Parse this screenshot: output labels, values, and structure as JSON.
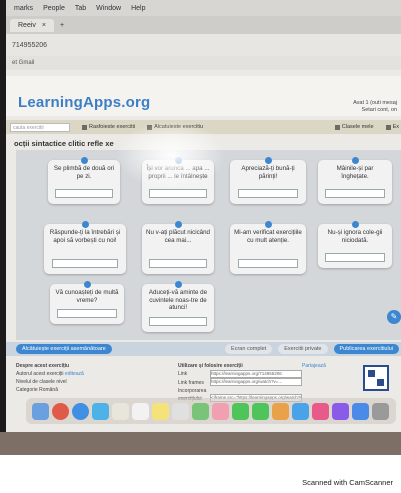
{
  "menubar": {
    "items": [
      "marks",
      "People",
      "Tab",
      "Window",
      "Help"
    ]
  },
  "browser": {
    "tab_label": "Reeiv",
    "tab_close": "×",
    "tab_add": "+",
    "url": "714955206",
    "bookmark": "et  Gmail"
  },
  "site": {
    "logo": "LearningApps.org",
    "header_right_line1": "Avat 1 (outi mesaj",
    "header_right_line2": "Setari cont, on"
  },
  "toolbar": {
    "search_placeholder": "cauta exercitii",
    "browse_label": "Rasfoieste exercitii",
    "create_label": "Alcatuieste exercitiu",
    "classes_label": "Clasele mele",
    "my_label": "Ex"
  },
  "page": {
    "title": "ocții sintactice clitic refle xe"
  },
  "cards": [
    {
      "text": "Se plimbă de două ori pe zi."
    },
    {
      "text": "Își vor arunca ... apa ... proprii ... le întâlnește"
    },
    {
      "text": "Apreciază-ți bună-ți părinți!"
    },
    {
      "text": "Mâinile-și par înghețate."
    },
    {
      "text": "Răspunde-ți la întrebări și apoi să vorbești cu noi!"
    },
    {
      "text": "Nu v-ați plăcut nicicând cea mai..."
    },
    {
      "text": "Mi-am verificat exercițiile cu mult atenție."
    },
    {
      "text": "Nu-și ignora cole-gii niciodată."
    },
    {
      "text": "Vă cunoașteți de multă vreme?"
    },
    {
      "text": "Aduceți-vă aminte de cuvintele noas-tre de atunci!"
    }
  ],
  "fab_icon": "pencil-icon",
  "actions": {
    "similar": "Alcătuiește exerciții asemănătoare",
    "fullscreen": "Ecran complet",
    "embed": "Exercitii private",
    "publish": "Publicarea exercitiului"
  },
  "info": {
    "about_title": "Despre acest exercițiu",
    "author_label": "Autorul acest exerciții",
    "edit_label": "editează",
    "level_label": "Nivelul de",
    "level_value": "clasele nivel",
    "category_label": "Categorie",
    "category_value": "Română",
    "use_title": "Utilizare și folosire exerciții",
    "share_label": "Partajează",
    "link1_label": "Link",
    "link1_value": "https://learningapps.org/714955206",
    "link2_label": "Link frames",
    "link2_value": "https://learningapps.org/watch?v=...",
    "embed_label": "Incorporarea exercițiului",
    "embed_value": "<iframe src=\"https://learningapps.org/watch?v=...\">",
    "download_label": "Descarcă o înregistrare"
  },
  "footer": {
    "scanner": "Scanned with CamScanner"
  },
  "colors": {
    "accent": "#3d86d0",
    "logo": "#3d7fc4",
    "board": "#d3d7da",
    "toolbar": "#dcd7c4"
  }
}
